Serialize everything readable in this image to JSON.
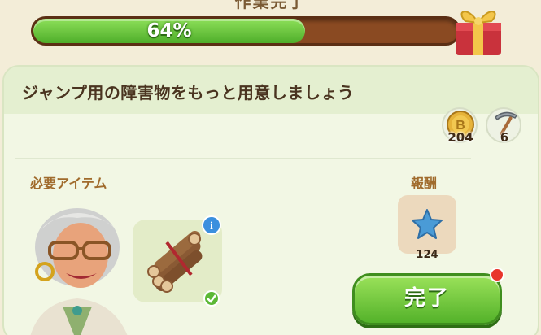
{
  "header": {
    "title": "作業完了"
  },
  "progress": {
    "percent": 64,
    "label": "64%"
  },
  "quest": {
    "title": "ジャンプ用の障害物をもっと用意しましょう"
  },
  "stats": [
    {
      "icon": "coin-b-icon",
      "value": "204"
    },
    {
      "icon": "pickaxe-icon",
      "value": "6"
    }
  ],
  "required": {
    "label": "必要アイテム",
    "item_icon": "logs-bundle-icon"
  },
  "reward": {
    "label": "報酬",
    "icon": "blue-star-icon",
    "count": "124"
  },
  "actions": {
    "complete_label": "完了"
  },
  "colors": {
    "accent_green": "#54b22a",
    "progress_track": "#8a4a22",
    "notify": "#e8352b"
  }
}
